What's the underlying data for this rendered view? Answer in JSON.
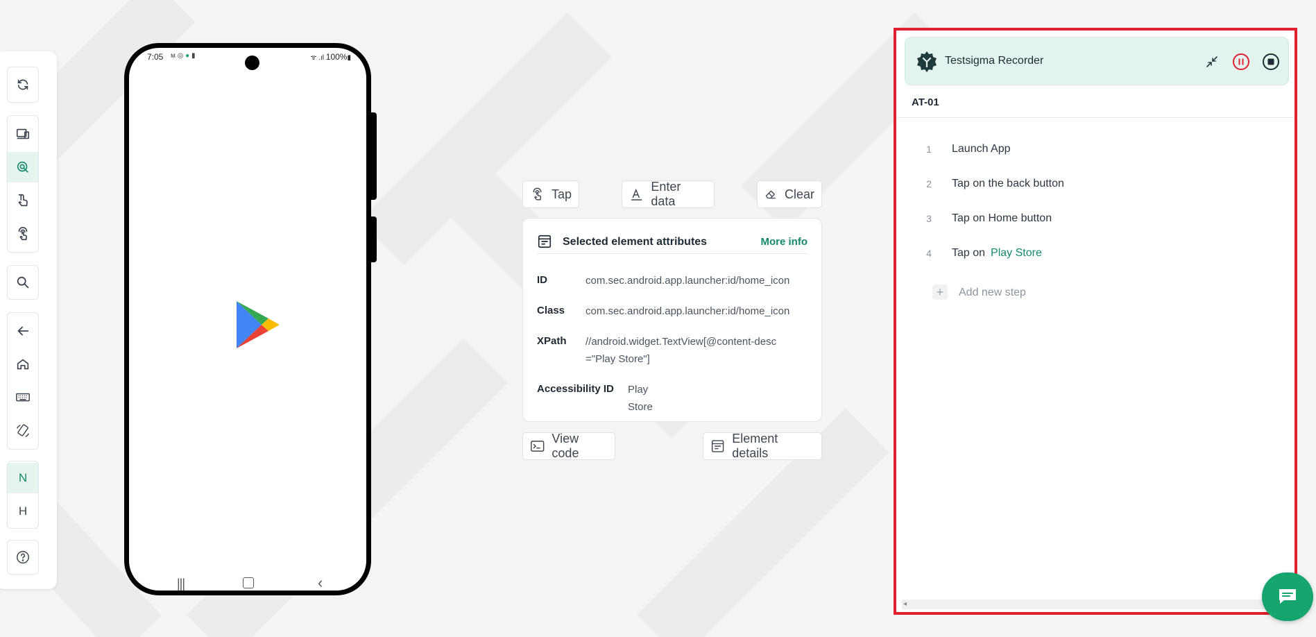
{
  "toolbar": {
    "items": [
      "refresh",
      "devices",
      "inspect",
      "touch",
      "tap-gesture",
      "search",
      "back",
      "home",
      "keyboard",
      "rotate"
    ],
    "letters": [
      "N",
      "H"
    ],
    "help": "?"
  },
  "phone": {
    "time": "7:05",
    "battery": "100%",
    "app_icon": "play-store-icon"
  },
  "actions": {
    "tap": "Tap",
    "enter_data": "Enter data",
    "clear": "Clear",
    "view_code": "View code",
    "element_details": "Element details"
  },
  "attributes": {
    "title": "Selected element attributes",
    "more_info": "More info",
    "rows": [
      {
        "key": "ID",
        "value": "com.sec.android.app.launcher:id/home_icon"
      },
      {
        "key": "Class",
        "value": "com.sec.android.app.launcher:id/home_icon"
      },
      {
        "key": "XPath",
        "value": "//android.widget.TextView[@content-desc",
        "value2": "=\"Play Store\"]"
      },
      {
        "key": "Accessibility ID",
        "value": "Play Store"
      }
    ]
  },
  "recorder": {
    "title": "Testsigma Recorder",
    "project": "AT-01",
    "steps": [
      {
        "num": "1",
        "text": "Launch App"
      },
      {
        "num": "2",
        "text": "Tap on the back button"
      },
      {
        "num": "3",
        "text": "Tap on Home button"
      },
      {
        "num": "4",
        "text": "Tap on",
        "highlight": "Play Store"
      }
    ],
    "add_step": "Add new step"
  },
  "colors": {
    "accent": "#14896a",
    "highlight_border": "#e0202e",
    "recorder_header_bg": "#e3f4ee",
    "chat_button": "#17a56f"
  }
}
